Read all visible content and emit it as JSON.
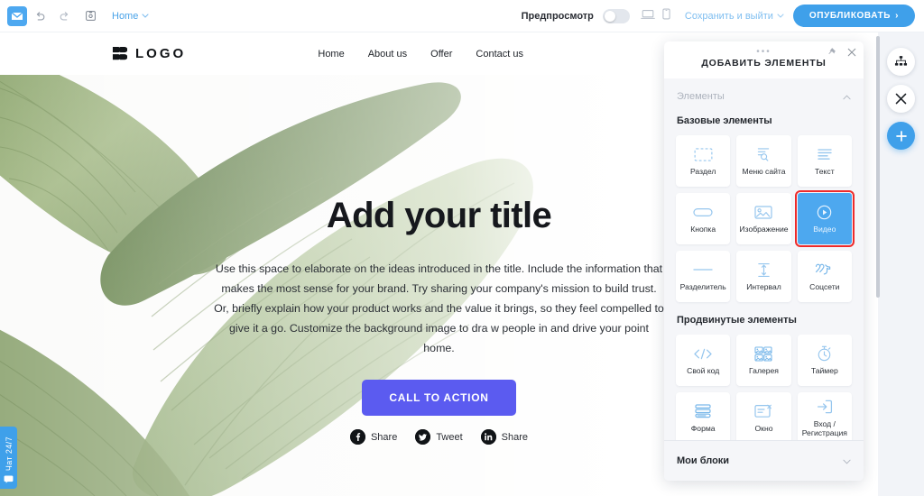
{
  "toolbar": {
    "mail_icon": "envelope-icon",
    "undo_icon": "undo-icon",
    "redo_icon": "redo-icon",
    "save_icon": "save-disk-icon",
    "page_selector_label": "Home",
    "preview_label": "Предпросмотр",
    "preview_toggle_state": "off",
    "desktop_icon": "laptop-icon",
    "mobile_icon": "phone-icon",
    "save_exit_label": "Сохранить и выйти",
    "publish_label": "ОПУБЛИКОВАТЬ",
    "publish_arrow": "›",
    "accent_blue": "#3fa0ea",
    "link_blue": "#7fbef0"
  },
  "site": {
    "logo_text": "LOGO",
    "nav": [
      {
        "label": "Home"
      },
      {
        "label": "About us"
      },
      {
        "label": "Offer"
      },
      {
        "label": "Contact us"
      }
    ],
    "hero": {
      "title": "Add your title",
      "paragraph": "Use this space to elaborate on the ideas introduced in the title. Include the information that makes the most sense for your brand. Try sharing your company's mission to build trust. Or, briefly explain how your product works and the value it brings, so they feel compelled to give it a go. Customize the background image to dra w people in and drive your point home.",
      "cta_label": "CALL TO ACTION",
      "cta_color": "#5b5bf0",
      "share": [
        {
          "icon": "facebook-icon",
          "label": "Share",
          "glyph": "f"
        },
        {
          "icon": "twitter-icon",
          "label": "Tweet",
          "glyph": "t"
        },
        {
          "icon": "linkedin-icon",
          "label": "Share",
          "glyph": "in"
        }
      ]
    },
    "chat_badge_label": "Чат 24/7"
  },
  "right_rail": {
    "sitemap_icon": "sitemap-icon",
    "close_icon": "close-icon",
    "add_icon": "plus-icon"
  },
  "panel": {
    "title": "ДОБАВИТЬ ЭЛЕМЕНТЫ",
    "pin_icon": "pin-icon",
    "close_icon": "close-icon",
    "grip": "•••",
    "section_label": "Элементы",
    "section_chevron": "chevron-up-icon",
    "group_basic_label": "Базовые элементы",
    "basic_tiles": [
      {
        "label": "Раздел",
        "icon": "section-dashed-icon",
        "selected": false
      },
      {
        "label": "Меню сайта",
        "icon": "site-menu-icon",
        "selected": false
      },
      {
        "label": "Текст",
        "icon": "text-lines-icon",
        "selected": false
      },
      {
        "label": "Кнопка",
        "icon": "button-pill-icon",
        "selected": false
      },
      {
        "label": "Изображение",
        "icon": "image-icon",
        "selected": false
      },
      {
        "label": "Видео",
        "icon": "play-circle-icon",
        "selected": true
      },
      {
        "label": "Разделитель",
        "icon": "divider-line-icon",
        "selected": false
      },
      {
        "label": "Интервал",
        "icon": "spacer-icon",
        "selected": false
      },
      {
        "label": "Соцсети",
        "icon": "social-icon",
        "selected": false
      }
    ],
    "group_advanced_label": "Продвинутые элементы",
    "advanced_tiles": [
      {
        "label": "Свой код",
        "icon": "code-icon",
        "selected": false
      },
      {
        "label": "Галерея",
        "icon": "gallery-grid-icon",
        "selected": false
      },
      {
        "label": "Таймер",
        "icon": "timer-icon",
        "selected": false
      },
      {
        "label": "Форма",
        "icon": "form-icon",
        "selected": false
      },
      {
        "label": "Окно",
        "icon": "window-popup-icon",
        "selected": false
      },
      {
        "label": "Вход / Регистрация",
        "icon": "login-icon",
        "selected": false
      }
    ],
    "footer_label": "Мои блоки",
    "footer_chevron": "chevron-down-icon",
    "selected_highlight_color": "#ee2b2b",
    "selected_tile_color": "#4da8ef"
  }
}
